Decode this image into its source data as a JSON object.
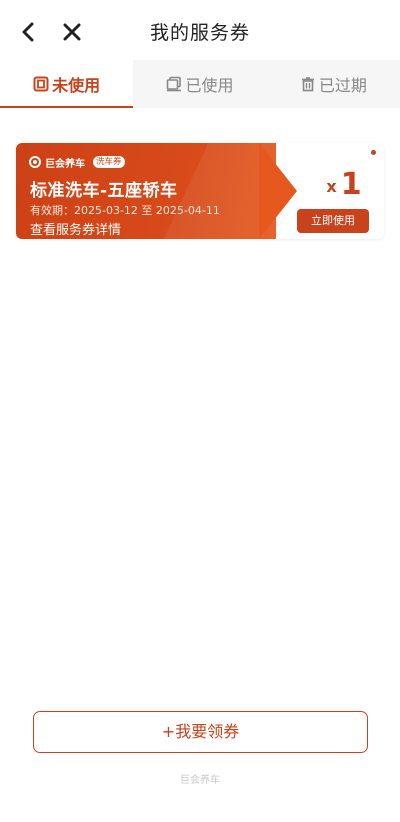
{
  "header": {
    "title": "我的服务券",
    "back_icon": "chevron-left-icon",
    "close_icon": "close-icon"
  },
  "tabs": [
    {
      "label": "未使用",
      "icon": "unused-ticket-icon",
      "active": true
    },
    {
      "label": "已使用",
      "icon": "used-stamp-icon",
      "active": false
    },
    {
      "label": "已过期",
      "icon": "trash-icon",
      "active": false
    }
  ],
  "coupon": {
    "brand": "巨会养车",
    "tag": "洗车券",
    "name": "标准洗车-五座轿车",
    "validity": "有效期：2025-03-12 至 2025-04-11",
    "detail_link": "查看服务券详情",
    "quantity_prefix": "x",
    "quantity": "1",
    "use_button": "立即使用"
  },
  "claim_button": "+我要领券",
  "footer": "巨会养车",
  "colors": {
    "accent": "#c8421b",
    "coupon_gradient_start": "#cc4115",
    "coupon_gradient_end": "#e8601f",
    "tab_bar_bg": "#f6f6f6"
  }
}
